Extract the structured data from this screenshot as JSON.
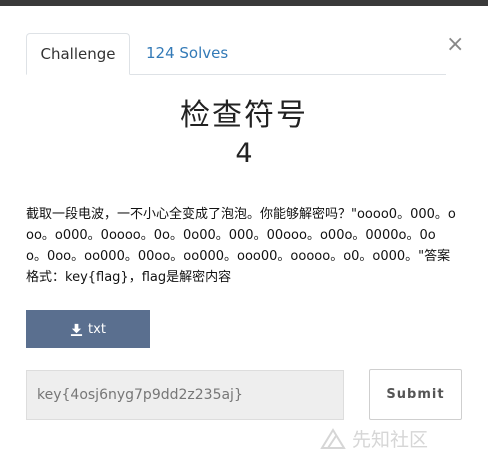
{
  "tabs": [
    {
      "label": "Challenge",
      "active": true
    },
    {
      "label": "124 Solves",
      "active": false
    }
  ],
  "close_glyph": "×",
  "challenge": {
    "title": "检查符号",
    "value": "4",
    "description": "截取一段电波，一不小心全变成了泡泡。你能够解密吗？\"oooo0。000。ooo。o000。0oooo。0o。0o00。000。00ooo。o00o。0000o。0oo。0oo。oo000。00oo。oo000。ooo00。ooooo。o0。o000。\"答案格式：key{flag}，flag是解密内容"
  },
  "download": {
    "label": "txt",
    "icon": "download-icon"
  },
  "submission": {
    "value": "key{4osj6nyg7p9dd2z235aj}",
    "placeholder": "",
    "submit_label": "Submit"
  },
  "watermark": {
    "text": "先知社区",
    "icon": "xianzhi-logo-icon"
  },
  "colors": {
    "tab_link": "#337ab7",
    "download_button": "#5a6f8f",
    "input_background": "#eeeeee"
  }
}
